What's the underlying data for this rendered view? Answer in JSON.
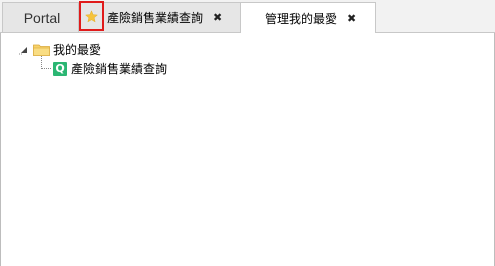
{
  "tabs": [
    {
      "label": "Portal"
    },
    {
      "label": "產險銷售業績查詢",
      "closable": true
    },
    {
      "label": "管理我的最愛",
      "closable": true,
      "active": true
    }
  ],
  "close_glyph": "✖",
  "favorite_star": {
    "icon": "star-icon",
    "color": "#f6c33b",
    "highlight_color": "#e01b1b"
  },
  "tree": {
    "root": {
      "label": "我的最愛",
      "icon": "folder-icon",
      "expanded": true
    },
    "children": [
      {
        "label": "產險銷售業績查詢",
        "icon_text": "Q",
        "icon_color": "#2bb673"
      }
    ]
  }
}
